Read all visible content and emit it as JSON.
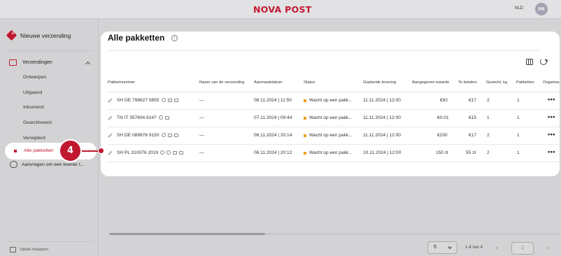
{
  "header": {
    "logo": "NOVA POST",
    "language": "NLD",
    "avatar_initials": "PR"
  },
  "sidebar": {
    "new_shipment": "Nieuwe verzending",
    "shipments_group": "Verzendingen",
    "items": [
      "Ontwerpen",
      "Uitgaand",
      "Inkomend",
      "Gearchiveerd",
      "Verwijderd"
    ],
    "active_item": "Alle pakketten",
    "courier_requests": "Aanvragen om een koerier t...",
    "collapse": "Zijbalk inklappen"
  },
  "callout": {
    "step": "4"
  },
  "main": {
    "title": "Alle pakketten",
    "columns": [
      "Pakketnummer",
      "Naam van de verzending",
      "Aanmaakdatum",
      "Status",
      "Geplande levering",
      "Aangegeven waarde",
      "Te betalen",
      "Gewicht, kg",
      "Pakketten",
      "Organisa"
    ],
    "rows": [
      {
        "number": "SH DE 798627 5855",
        "name": "—",
        "created": "08.11.2024 | 11:50",
        "status": "Wacht op een pakk...",
        "delivery": "11.11.2024 | 12:00",
        "declared": "€92",
        "to_pay": "€17",
        "weight": "2",
        "parcels": "1"
      },
      {
        "number": "TN IT 357604 6247",
        "name": "—",
        "created": "07.11.2024 | 09:44",
        "status": "Wacht op een pakk...",
        "delivery": "11.11.2024 | 12:00",
        "declared": "€0.01",
        "to_pay": "€15",
        "weight": "1",
        "parcels": "1"
      },
      {
        "number": "SH DE 089876 9150",
        "name": "—",
        "created": "06.11.2024 | 20:14",
        "status": "Wacht op een pakk...",
        "delivery": "11.11.2024 | 12:00",
        "declared": "€200",
        "to_pay": "€17",
        "weight": "2",
        "parcels": "1"
      },
      {
        "number": "SH PL 310076 2019",
        "name": "—",
        "created": "06.11.2024 | 20:12",
        "status": "Wacht op een pakk...",
        "delivery": "10.11.2024 | 12:00",
        "declared": "150 zł",
        "to_pay": "55 zł",
        "weight": "2",
        "parcels": "1"
      }
    ],
    "row_menu": "•••"
  },
  "pagination": {
    "page_size": "5",
    "range": "1-4 van 4",
    "page_input": "1",
    "prev": "‹",
    "next": "›"
  },
  "colors": {
    "brand": "#c0182f",
    "status_pending": "#f0a020"
  }
}
